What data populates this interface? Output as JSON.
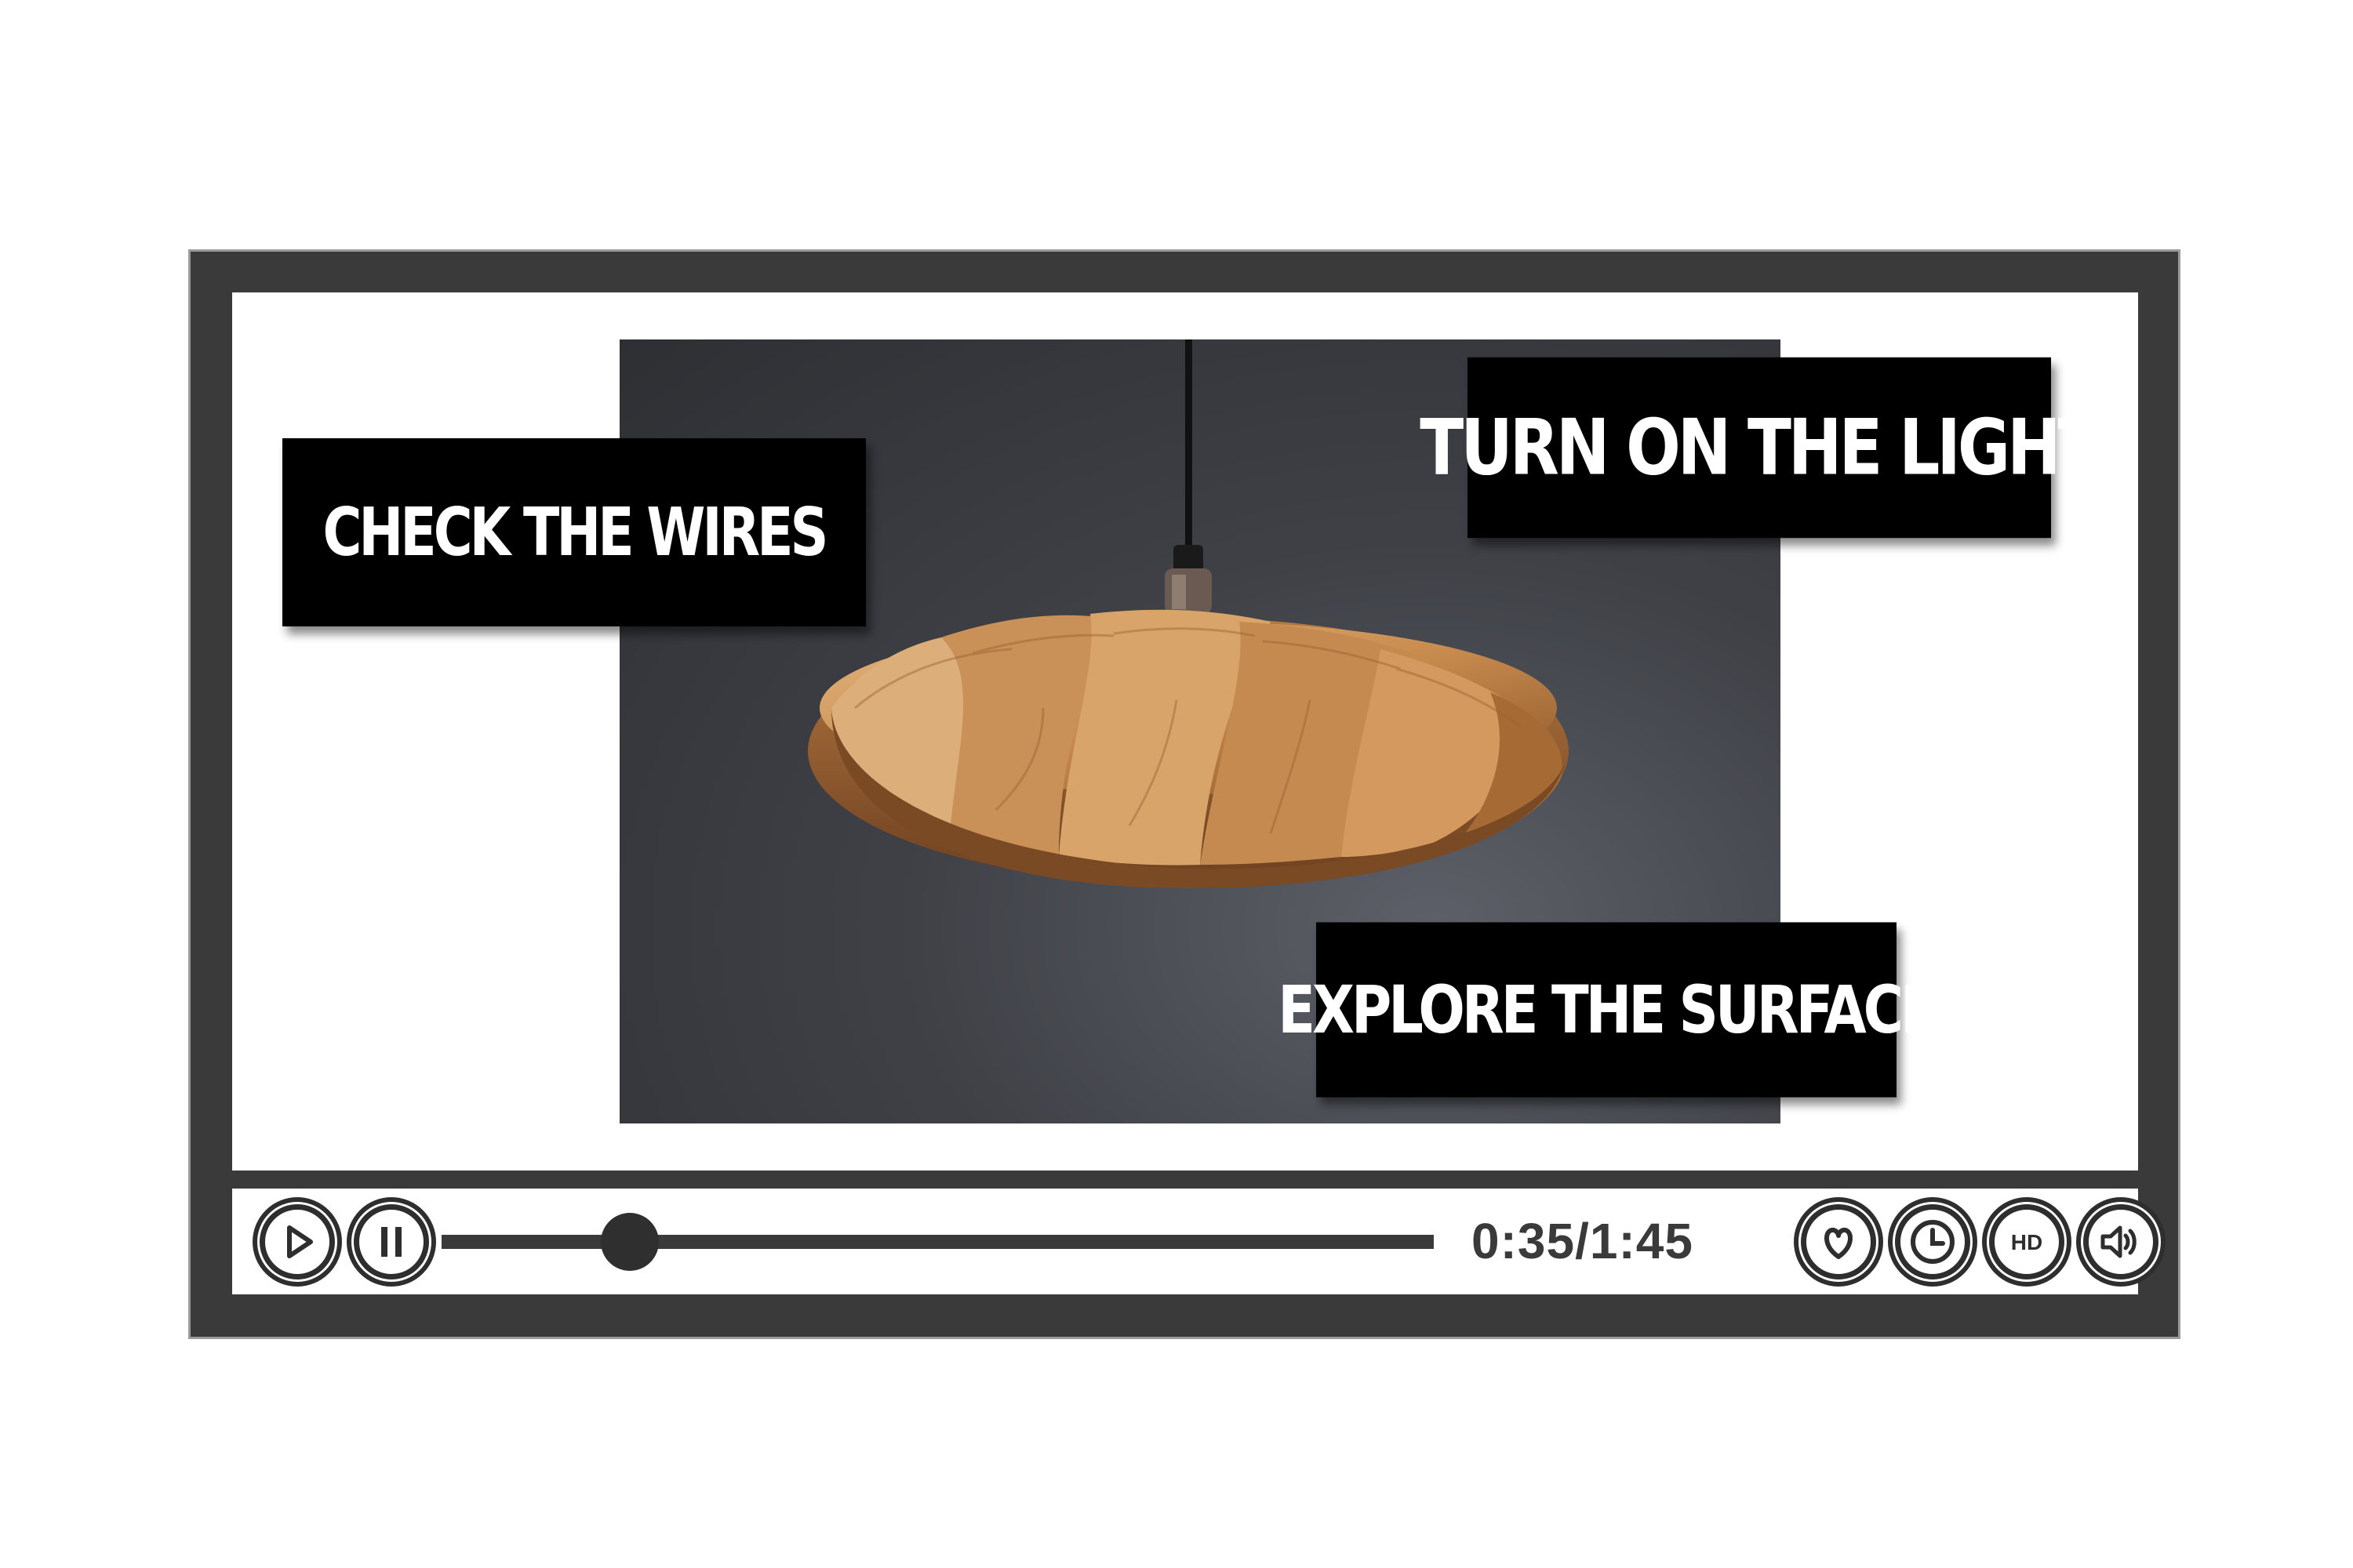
{
  "callouts": {
    "wires": "CHECK THE WIRES",
    "light": "Turn on the light",
    "surface": "EXPLORE THE SURFACE"
  },
  "controls": {
    "time": "0:35/1:45",
    "progress_fraction": 0.19,
    "hd_label": "HD"
  },
  "icons": {
    "play": "play-icon",
    "pause": "pause-icon",
    "favorite": "heart-icon",
    "clock": "clock-icon",
    "hd": "hd-icon",
    "volume": "volume-icon"
  },
  "colors": {
    "frame": "#3b3a3b",
    "callout_bg": "#000000",
    "callout_text": "#ffffff",
    "control_dark": "#2e2e2e"
  }
}
